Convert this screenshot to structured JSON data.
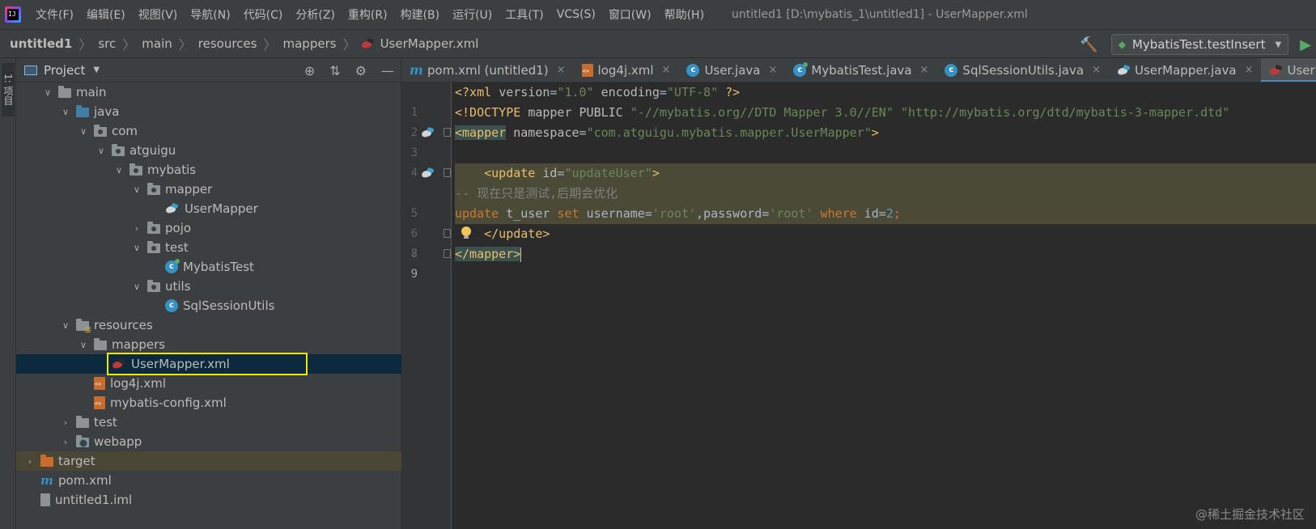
{
  "menubar": {
    "items": [
      "文件(F)",
      "编辑(E)",
      "视图(V)",
      "导航(N)",
      "代码(C)",
      "分析(Z)",
      "重构(R)",
      "构建(B)",
      "运行(U)",
      "工具(T)",
      "VCS(S)",
      "窗口(W)",
      "帮助(H)"
    ],
    "window_title": "untitled1 [D:\\mybatis_1\\untitled1] - UserMapper.xml"
  },
  "breadcrumb": {
    "items": [
      "untitled1",
      "src",
      "main",
      "resources",
      "mappers",
      "UserMapper.xml"
    ]
  },
  "run": {
    "config_label": "MybatisTest.testInsert"
  },
  "tool_strip": {
    "tab_label": "1: 项目"
  },
  "project": {
    "title": "Project",
    "tree": [
      {
        "label": "main",
        "arrow": "down",
        "icon": "folder"
      },
      {
        "label": "java",
        "arrow": "down",
        "icon": "folder-src"
      },
      {
        "label": "com",
        "arrow": "down",
        "icon": "package"
      },
      {
        "label": "atguigu",
        "arrow": "down",
        "icon": "package"
      },
      {
        "label": "mybatis",
        "arrow": "down",
        "icon": "package"
      },
      {
        "label": "mapper",
        "arrow": "down",
        "icon": "package"
      },
      {
        "label": "UserMapper",
        "arrow": "none",
        "icon": "mybatis"
      },
      {
        "label": "pojo",
        "arrow": "right",
        "icon": "package"
      },
      {
        "label": "test",
        "arrow": "down",
        "icon": "package"
      },
      {
        "label": "MybatisTest",
        "arrow": "none",
        "icon": "java-c-test"
      },
      {
        "label": "utils",
        "arrow": "down",
        "icon": "package"
      },
      {
        "label": "SqlSessionUtils",
        "arrow": "none",
        "icon": "java-c"
      },
      {
        "label": "resources",
        "arrow": "down",
        "icon": "folder-res"
      },
      {
        "label": "mappers",
        "arrow": "down",
        "icon": "folder"
      },
      {
        "label": "UserMapper.xml",
        "arrow": "none",
        "icon": "mybatis-red"
      },
      {
        "label": "log4j.xml",
        "arrow": "none",
        "icon": "xml"
      },
      {
        "label": "mybatis-config.xml",
        "arrow": "none",
        "icon": "xml"
      },
      {
        "label": "test",
        "arrow": "right",
        "icon": "folder"
      },
      {
        "label": "webapp",
        "arrow": "right",
        "icon": "webapp"
      },
      {
        "label": "target",
        "arrow": "right",
        "icon": "folder-orange"
      },
      {
        "label": "pom.xml",
        "arrow": "none",
        "icon": "maven"
      },
      {
        "label": "untitled1.iml",
        "arrow": "none",
        "icon": "iml"
      }
    ]
  },
  "tabs": [
    {
      "label": "pom.xml (untitled1)",
      "icon": "maven"
    },
    {
      "label": "log4j.xml",
      "icon": "xml"
    },
    {
      "label": "User.java",
      "icon": "java-c"
    },
    {
      "label": "MybatisTest.java",
      "icon": "java-c-test"
    },
    {
      "label": "SqlSessionUtils.java",
      "icon": "java-c"
    },
    {
      "label": "UserMapper.java",
      "icon": "mybatis"
    },
    {
      "label": "UserM",
      "icon": "mybatis-red"
    }
  ],
  "editor": {
    "line_numbers": [
      "1",
      "2",
      "3",
      "4",
      "5",
      "6",
      "7",
      "8",
      "9"
    ],
    "lines": {
      "l1": {
        "decl_open": "<?xml ",
        "a1": "version",
        "eq1": "=",
        "v1": "\"1.0\"",
        "sp": " ",
        "a2": "encoding",
        "eq2": "=",
        "v2": "\"UTF-8\"",
        "decl_close": " ?>"
      },
      "l2": {
        "open": "<!DOCTYPE ",
        "name": "mapper ",
        "pub": "PUBLIC ",
        "s1": "\"-//mybatis.org//DTD Mapper 3.0//EN\"",
        "sp": " ",
        "s2": "\"http://mybatis.org/dtd/mybatis-3-mapper.dtd\""
      },
      "l3": {
        "tag": "<mapper",
        "sp": " ",
        "attr": "namespace",
        "eq": "=",
        "val": "\"com.atguigu.mybatis.mapper.UserMapper\"",
        "close": ">"
      },
      "l5": {
        "indent": "    ",
        "tag": "<update",
        "sp": " ",
        "attr": "id",
        "eq": "=",
        "val": "\"updateUser\"",
        "close": ">"
      },
      "l6": {
        "comment": "-- 现在只是测试,后期会优化"
      },
      "l7": {
        "kw1": "update",
        "t1": " t_user ",
        "kw2": "set",
        "t2": " username=",
        "s1": "'root'",
        "t3": ",password=",
        "s2": "'root'",
        "sp": " ",
        "kw3": "where",
        "t4": " id=",
        "num": "2",
        "semi": ";"
      },
      "l8": {
        "indent": "    ",
        "tag": "</update>"
      },
      "l9": {
        "tag": "</mapper",
        "close": ">"
      }
    }
  },
  "watermark": "@稀土掘金技术社区",
  "colors": {
    "bg_editor": "#2b2b2b",
    "bg_panel": "#3c3f41",
    "selection": "#0d293e",
    "highlight_box": "#f4e800",
    "keyword": "#cc7832",
    "string": "#6a8759",
    "number": "#6897bb",
    "tag": "#e8bf6a",
    "comment": "#808080"
  }
}
